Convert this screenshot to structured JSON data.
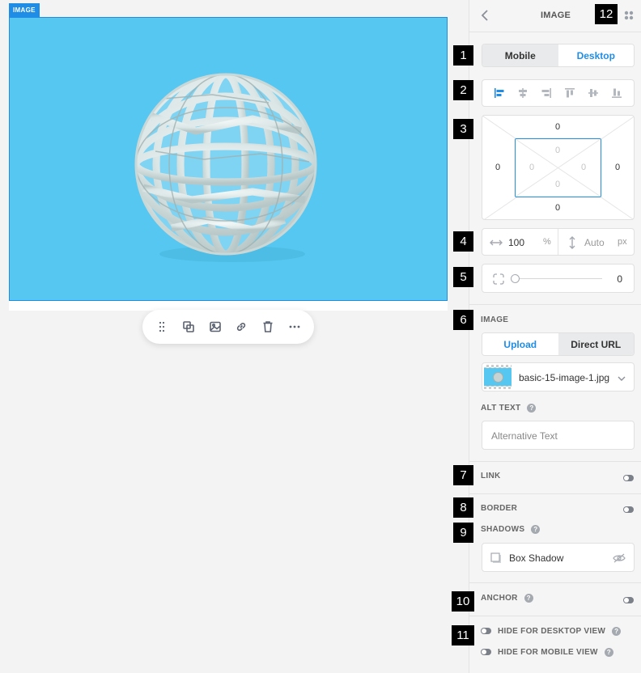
{
  "canvas": {
    "image_tag": "IMAGE",
    "colors": {
      "image_bg": "#56c7f1",
      "accent": "#1f8de6"
    },
    "toolbar": {
      "icons": [
        "drag-handle-icon",
        "duplicate-icon",
        "replace-image-icon",
        "link-icon",
        "delete-icon",
        "more-icon"
      ]
    }
  },
  "panel": {
    "title": "IMAGE",
    "device": {
      "mobile": "Mobile",
      "desktop": "Desktop",
      "active": "Desktop"
    },
    "spacing": {
      "margin": {
        "top": "0",
        "right": "0",
        "bottom": "0",
        "left": "0"
      },
      "padding": {
        "top": "0",
        "right": "0",
        "bottom": "0",
        "left": "0"
      }
    },
    "size": {
      "width": "100",
      "width_unit": "%",
      "height": "Auto",
      "height_unit": "px"
    },
    "radius": {
      "value": "0"
    },
    "image_section": {
      "label": "IMAGE",
      "upload": "Upload",
      "direct_url": "Direct URL",
      "active": "Upload",
      "file_name": "basic-15-image-1.jpg",
      "alt_label": "ALT TEXT",
      "alt_placeholder": "Alternative Text"
    },
    "link_label": "LINK",
    "border_label": "BORDER",
    "shadows_label": "SHADOWS",
    "box_shadow": "Box Shadow",
    "anchor_label": "ANCHOR",
    "hide_desktop": "HIDE FOR DESKTOP VIEW",
    "hide_mobile": "HIDE FOR MOBILE VIEW",
    "help_glyph": "?"
  },
  "badges": [
    "1",
    "2",
    "3",
    "4",
    "5",
    "6",
    "7",
    "8",
    "9",
    "10",
    "11",
    "12"
  ]
}
